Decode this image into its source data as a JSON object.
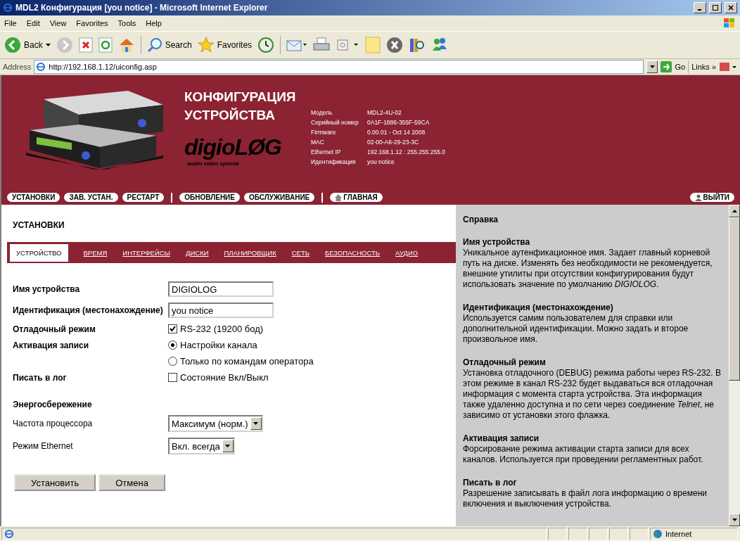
{
  "window": {
    "title": "MDL2 Конфигурация [you notice] - Microsoft Internet Explorer"
  },
  "menu": [
    "File",
    "Edit",
    "View",
    "Favorites",
    "Tools",
    "Help"
  ],
  "toolbar": {
    "back": "Back",
    "search": "Search",
    "favorites": "Favorites"
  },
  "address": {
    "label": "Address",
    "url": "http://192.168.1.12/uiconfig.asp",
    "go": "Go",
    "links": "Links »"
  },
  "header": {
    "title": [
      "КОНФИГУРАЦИЯ",
      "УСТРОЙСТВА"
    ],
    "logo": "digioLØG",
    "tagline": "audio video special",
    "info": [
      {
        "label": "Модель",
        "value": "MDL2-4U-02"
      },
      {
        "label": "Серийный номер",
        "value": "0A1F-1886-355F-59CA"
      },
      {
        "label": "Firmware",
        "value": "0.00.01 - Oct 14 2008"
      },
      {
        "label": "MAC",
        "value": "02-00-A6-29-23-3C"
      },
      {
        "label": "Ethernet IP",
        "value": "192.168.1.12 : 255.255.255.0"
      },
      {
        "label": "Идентификация",
        "value": "you notice"
      }
    ],
    "nav": [
      [
        {
          "kind": "plain",
          "label": "УСТАНОВКИ"
        },
        {
          "kind": "plain",
          "label": "ЗАВ. УСТАН."
        },
        {
          "kind": "plain",
          "label": "РЕСТАРТ"
        }
      ],
      [
        {
          "kind": "plain",
          "label": "ОБНОВЛЕНИЕ"
        },
        {
          "kind": "plain",
          "label": "ОБСЛУЖИВАНИЕ"
        }
      ],
      [
        {
          "kind": "home",
          "label": "ГЛАВНАЯ"
        }
      ]
    ],
    "logout": "ВЫЙТИ"
  },
  "section": "УСТАНОВКИ",
  "tabs": [
    {
      "label": "УСТРОЙСТВО",
      "selected": true
    },
    {
      "label": "ВРЕМЯ",
      "selected": false
    },
    {
      "label": "ИНТЕРФЕЙСЫ",
      "selected": false
    },
    {
      "label": "ДИСКИ",
      "selected": false
    },
    {
      "label": "ПЛАНИРОВЩИК",
      "selected": false
    },
    {
      "label": "СЕТЬ",
      "selected": false
    },
    {
      "label": "БЕЗОПАСНОСТЬ",
      "selected": false
    },
    {
      "label": "АУДИО",
      "selected": false
    }
  ],
  "form": [
    {
      "kind": "text",
      "label": "Имя устройства",
      "value": "DIGIOLOG"
    },
    {
      "kind": "text",
      "label": "Идентификация (местонахождение)",
      "value": "you notice"
    },
    {
      "kind": "checkbox",
      "label": "Отладочный режим",
      "option": "RS-232 (19200 бод)",
      "checked": true
    },
    {
      "kind": "radio",
      "label": "Активация записи",
      "options": [
        {
          "label": "Настройки канала",
          "selected": true
        },
        {
          "label": "Только по командам оператора",
          "selected": false
        }
      ]
    },
    {
      "kind": "checkbox",
      "label": "Писать в лог",
      "option": "Состояние Вкл/Выкл",
      "checked": false
    },
    {
      "kind": "heading",
      "label": "Энергосбережение"
    },
    {
      "kind": "select",
      "label": "Частота процессора",
      "value": "Максимум (норм.)"
    },
    {
      "kind": "select",
      "label": "Режим Ethernet",
      "value": "Вкл. всегда"
    }
  ],
  "buttons": [
    "Установить",
    "Отмена"
  ],
  "help": {
    "title": "Справка",
    "topics": [
      {
        "title": "Имя устройства",
        "text": "Уникальное аутенфикационное имя. Задает главный корневой путь на диске. Изменять без необходимости не рекомендуется, внешние утилиты при отсутствии конфигурирования будут использовать значение по умолчанию *DIGIOLOG*."
      },
      {
        "title": "Идентификация (местонахождение)",
        "text": "Используется самим пользователем для справки или дополнительной идентификации. Можно задать и второе произвольное имя."
      },
      {
        "title": "Отладочный режим",
        "text": "Установка отладочного (DEBUG) режима работы через RS-232. В этом режиме в канал RS-232 будет выдаваться вся отладочная информация с момента старта устройства. Эта информация также удаленно доступна и по сети через соединение *Telnet*, не зависимо от установки этого флажка."
      },
      {
        "title": "Активация записи",
        "text": "Форсирование режима активации старта записи для всех каналов. Используется при проведении регламентных работ."
      },
      {
        "title": "Писать в лог",
        "text": "Разрешение записывать в файл лога информацию о времени включения и выключения устройства."
      }
    ]
  },
  "status_bar": {
    "zone": "Internet"
  }
}
